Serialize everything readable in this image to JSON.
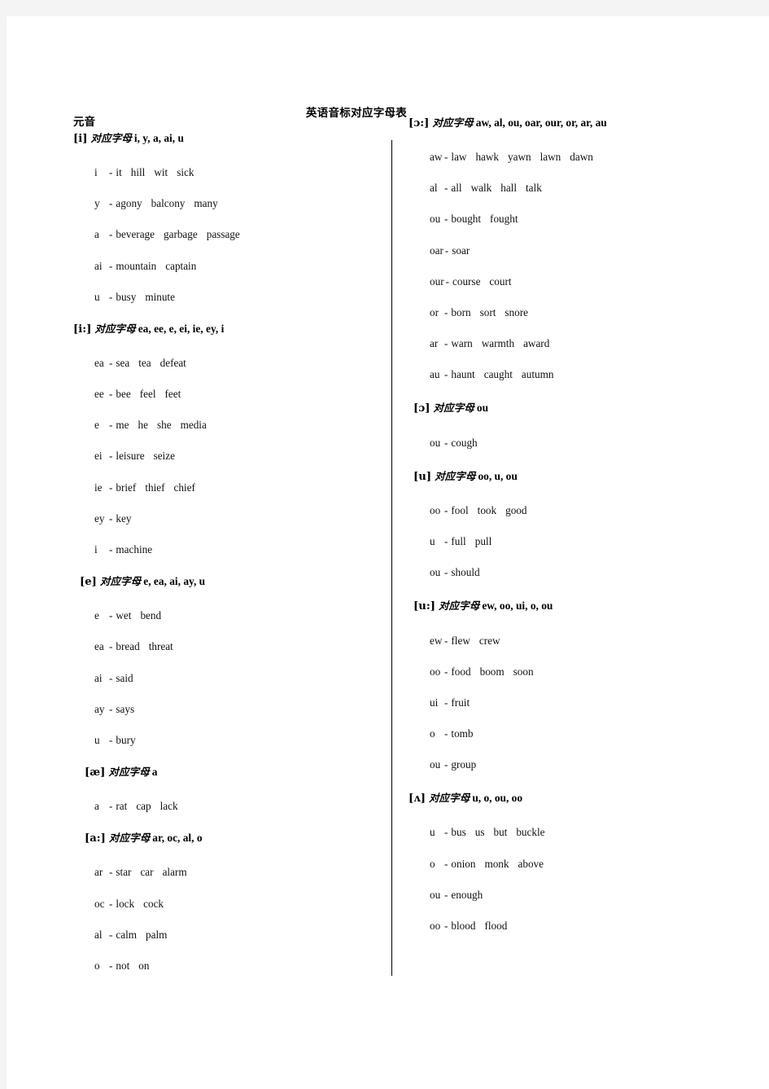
{
  "document": {
    "title": "英语音标对应字母表",
    "vowel_heading": "元音"
  },
  "left_column": [
    {
      "symbol": "[i]",
      "cn_label": "对应字母",
      "letters": "i, y, a, ai, u",
      "head_indent": 0,
      "rows": [
        {
          "letter": "i",
          "words": [
            "it",
            "hill",
            "wit",
            "sick"
          ]
        },
        {
          "letter": "y",
          "words": [
            "agony",
            "balcony",
            "many"
          ]
        },
        {
          "letter": "a",
          "words": [
            "beverage",
            "garbage",
            "passage"
          ]
        },
        {
          "letter": "ai",
          "words": [
            "mountain",
            "captain"
          ]
        },
        {
          "letter": "u",
          "words": [
            "busy",
            "minute"
          ]
        }
      ]
    },
    {
      "symbol": "[i:]",
      "cn_label": "对应字母",
      "letters": "ea, ee, e, ei, ie, ey, i",
      "head_indent": 0,
      "rows": [
        {
          "letter": "ea",
          "words": [
            "sea",
            "tea",
            "defeat"
          ]
        },
        {
          "letter": "ee",
          "words": [
            "bee",
            "feel",
            "feet"
          ]
        },
        {
          "letter": "e",
          "words": [
            "me",
            "he",
            "she",
            "media"
          ]
        },
        {
          "letter": "ei",
          "words": [
            "leisure",
            "seize"
          ]
        },
        {
          "letter": "ie",
          "words": [
            "brief",
            "thief",
            "chief"
          ]
        },
        {
          "letter": "ey",
          "words": [
            "key"
          ]
        },
        {
          "letter": "i",
          "words": [
            "machine"
          ]
        }
      ]
    },
    {
      "symbol": "[e]",
      "cn_label": "对应字母",
      "letters": "e, ea, ai, ay, u",
      "head_indent": 8,
      "rows": [
        {
          "letter": "e",
          "words": [
            "wet",
            "bend"
          ]
        },
        {
          "letter": "ea",
          "words": [
            "bread",
            "threat"
          ]
        },
        {
          "letter": "ai",
          "words": [
            "said"
          ]
        },
        {
          "letter": "ay",
          "words": [
            "says"
          ]
        },
        {
          "letter": "u",
          "words": [
            "bury"
          ]
        }
      ]
    },
    {
      "symbol": "[æ]",
      "cn_label": "对应字母",
      "letters": "a",
      "head_indent": 14,
      "rows": [
        {
          "letter": "a",
          "words": [
            "rat",
            "cap",
            "lack"
          ]
        }
      ]
    },
    {
      "symbol": "[a:]",
      "cn_label": "对应字母",
      "letters": "ar, oc, al, o",
      "head_indent": 14,
      "rows": [
        {
          "letter": "ar",
          "words": [
            "star",
            "car",
            "alarm"
          ]
        },
        {
          "letter": "oc",
          "words": [
            "lock",
            "cock"
          ]
        },
        {
          "letter": "al",
          "words": [
            "calm",
            "palm"
          ]
        },
        {
          "letter": "o",
          "words": [
            "not",
            "on"
          ]
        }
      ]
    }
  ],
  "right_column": [
    {
      "symbol": "[ɔ:]",
      "cn_label": "对应字母",
      "letters": "aw, al, ou, oar, our, or, ar, au",
      "head_indent": 0,
      "rows": [
        {
          "letter": "aw",
          "words": [
            "law",
            "hawk",
            "yawn",
            "lawn",
            "dawn"
          ]
        },
        {
          "letter": "al",
          "words": [
            "all",
            "walk",
            "hall",
            "talk"
          ]
        },
        {
          "letter": "ou",
          "words": [
            "bought",
            "fought"
          ]
        },
        {
          "letter": "oar",
          "words": [
            "soar"
          ]
        },
        {
          "letter": "our",
          "words": [
            "course",
            "court"
          ]
        },
        {
          "letter": "or",
          "words": [
            "born",
            "sort",
            "snore"
          ]
        },
        {
          "letter": "ar",
          "words": [
            "warn",
            "warmth",
            "award"
          ]
        },
        {
          "letter": "au",
          "words": [
            "haunt",
            "caught",
            "autumn"
          ]
        }
      ]
    },
    {
      "symbol": "[ɔ]",
      "cn_label": "对应字母",
      "letters": "ou",
      "head_indent": 6,
      "rows": [
        {
          "letter": "ou",
          "words": [
            "cough"
          ]
        }
      ]
    },
    {
      "symbol": "[u]",
      "cn_label": "对应字母",
      "letters": "oo, u, ou",
      "head_indent": 6,
      "rows": [
        {
          "letter": "oo",
          "words": [
            "fool",
            "took",
            "good"
          ]
        },
        {
          "letter": "u",
          "words": [
            "full",
            "pull"
          ]
        },
        {
          "letter": "ou",
          "words": [
            "should"
          ]
        }
      ]
    },
    {
      "symbol": "[u:]",
      "cn_label": "对应字母",
      "letters": "ew, oo, ui, o, ou",
      "head_indent": 6,
      "rows": [
        {
          "letter": "ew",
          "words": [
            "flew",
            "crew"
          ]
        },
        {
          "letter": "oo",
          "words": [
            "food",
            "boom",
            "soon"
          ]
        },
        {
          "letter": "ui",
          "words": [
            "fruit"
          ]
        },
        {
          "letter": "o",
          "words": [
            "tomb"
          ]
        },
        {
          "letter": "ou",
          "words": [
            "group"
          ]
        }
      ]
    },
    {
      "symbol": "[ʌ]",
      "cn_label": "对应字母",
      "letters": "u, o, ou, oo",
      "head_indent": 0,
      "rows": [
        {
          "letter": "u",
          "words": [
            "bus",
            "us",
            "but",
            "buckle"
          ]
        },
        {
          "letter": "o",
          "words": [
            "onion",
            "monk",
            "above"
          ]
        },
        {
          "letter": "ou",
          "words": [
            "enough"
          ]
        },
        {
          "letter": "oo",
          "words": [
            "blood",
            "flood"
          ]
        }
      ]
    }
  ],
  "colors": {
    "page_background": "#ffffff",
    "canvas_background": "#f4f4f4",
    "text": "#000000",
    "rule": "#000000"
  }
}
